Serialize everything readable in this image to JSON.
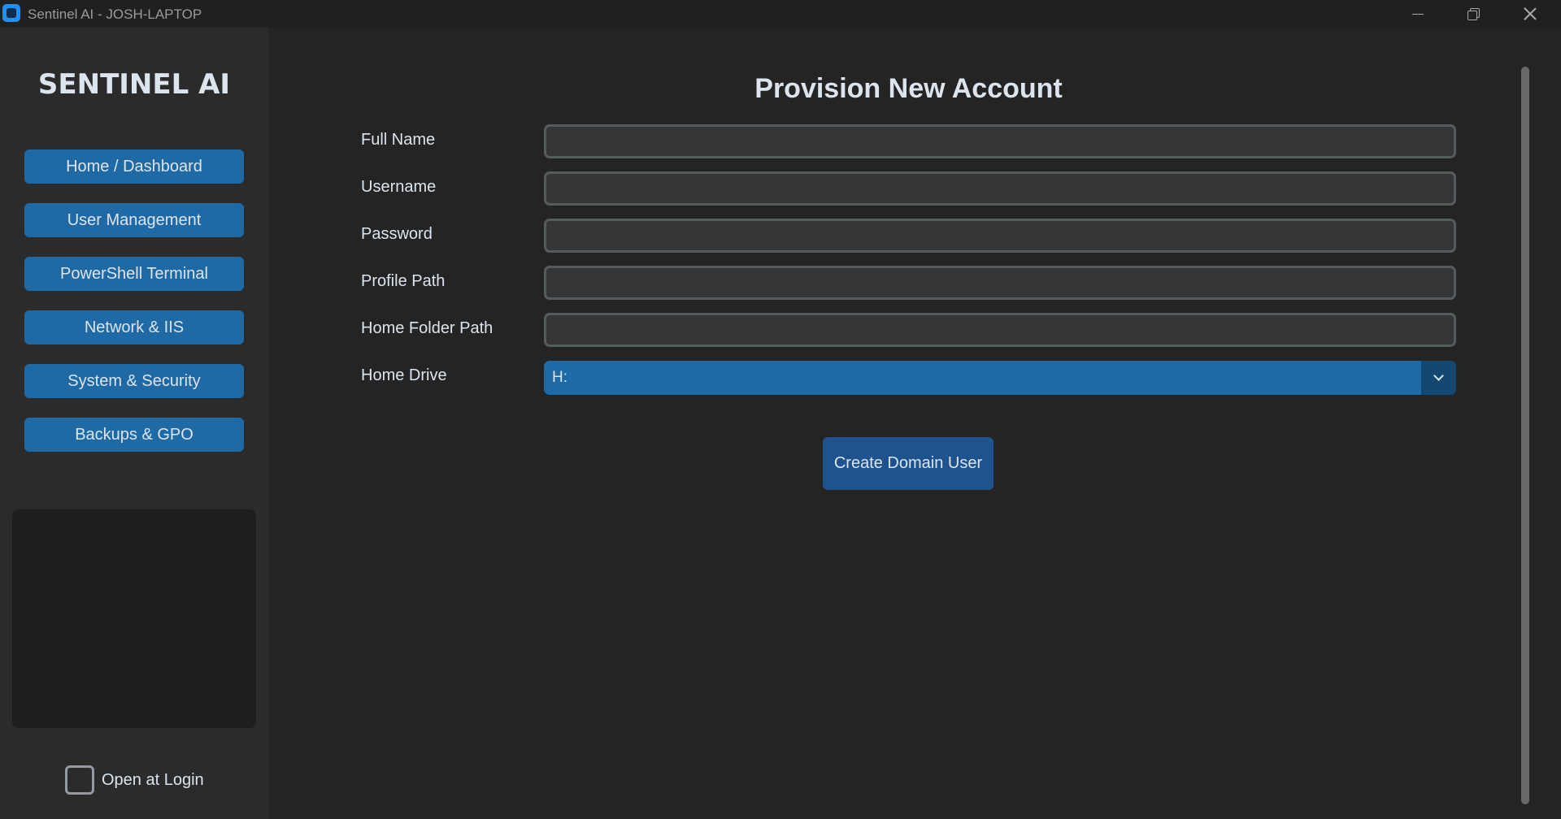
{
  "window": {
    "title": "Sentinel AI - JOSH-LAPTOP",
    "app_icon": "app-logo-icon"
  },
  "sidebar": {
    "brand": "SENTINEL AI",
    "items": [
      {
        "label": "Home / Dashboard"
      },
      {
        "label": "User Management"
      },
      {
        "label": "PowerShell Terminal"
      },
      {
        "label": "Network & IIS"
      },
      {
        "label": "System & Security"
      },
      {
        "label": "Backups & GPO"
      }
    ],
    "open_at_login": {
      "label": "Open at Login",
      "checked": false
    }
  },
  "main": {
    "title": "Provision New Account",
    "fields": [
      {
        "label": "Full Name",
        "value": ""
      },
      {
        "label": "Username",
        "value": ""
      },
      {
        "label": "Password",
        "value": ""
      },
      {
        "label": "Profile Path",
        "value": ""
      },
      {
        "label": "Home Folder Path",
        "value": ""
      }
    ],
    "home_drive": {
      "label": "Home Drive",
      "value": "H:"
    },
    "create_button": "Create Domain User"
  },
  "colors": {
    "background": "#242424",
    "sidebar": "#2b2b2b",
    "accent": "#1f6aa5",
    "accent_dark": "#1f538d",
    "input_bg": "#343638",
    "input_border": "#565b5e",
    "text": "#dce4ee"
  }
}
